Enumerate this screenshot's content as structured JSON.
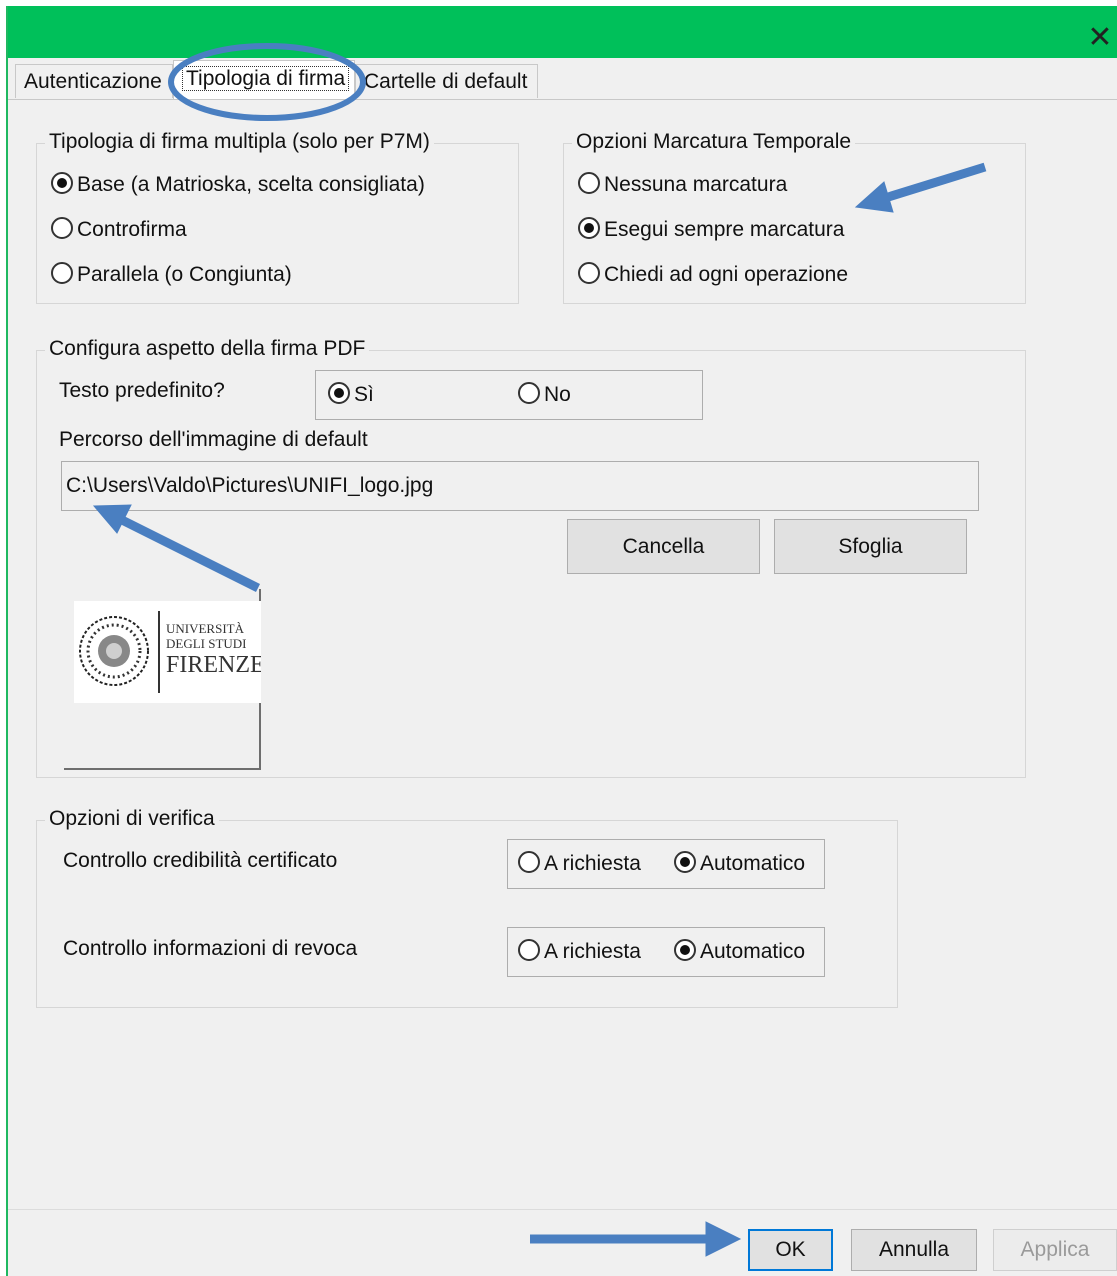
{
  "window": {
    "close_glyph": "✕",
    "titlebar_color": "#00c05a"
  },
  "tabs": [
    {
      "label": "Autenticazione"
    },
    {
      "label": "Tipologia di firma"
    },
    {
      "label": "Cartelle di default"
    }
  ],
  "multi_sign": {
    "title": "Tipologia di firma multipla (solo per P7M)",
    "options": [
      {
        "label": "Base (a Matrioska, scelta consigliata)",
        "selected": true
      },
      {
        "label": "Controfirma",
        "selected": false
      },
      {
        "label": "Parallela (o Congiunta)",
        "selected": false
      }
    ]
  },
  "timestamp": {
    "title": "Opzioni Marcatura Temporale",
    "options": [
      {
        "label": "Nessuna marcatura",
        "selected": false
      },
      {
        "label": "Esegui sempre marcatura",
        "selected": true
      },
      {
        "label": "Chiedi ad ogni operazione",
        "selected": false
      }
    ]
  },
  "pdf": {
    "title": "Configura aspetto della firma PDF",
    "default_text_label": "Testo predefinito?",
    "yes_label": "Sì",
    "no_label": "No",
    "yes_selected": true,
    "image_path_label": "Percorso dell'immagine di default",
    "image_path": "C:\\Users\\Valdo\\Pictures\\UNIFI_logo.jpg",
    "cancel_label": "Cancella",
    "browse_label": "Sfoglia",
    "logo_lines": [
      "UNIVERSITÀ",
      "DEGLI STUDI",
      "FIRENZE"
    ]
  },
  "verify": {
    "title": "Opzioni di verifica",
    "rows": [
      {
        "label": "Controllo credibilità certificato",
        "opt_a": "A richiesta",
        "opt_b": "Automatico",
        "selected": "b"
      },
      {
        "label": "Controllo informazioni di revoca",
        "opt_a": "A richiesta",
        "opt_b": "Automatico",
        "selected": "b"
      }
    ]
  },
  "footer": {
    "ok_label": "OK",
    "cancel_label": "Annulla",
    "apply_label": "Applica"
  },
  "annotation_color": "#4a7fc1"
}
